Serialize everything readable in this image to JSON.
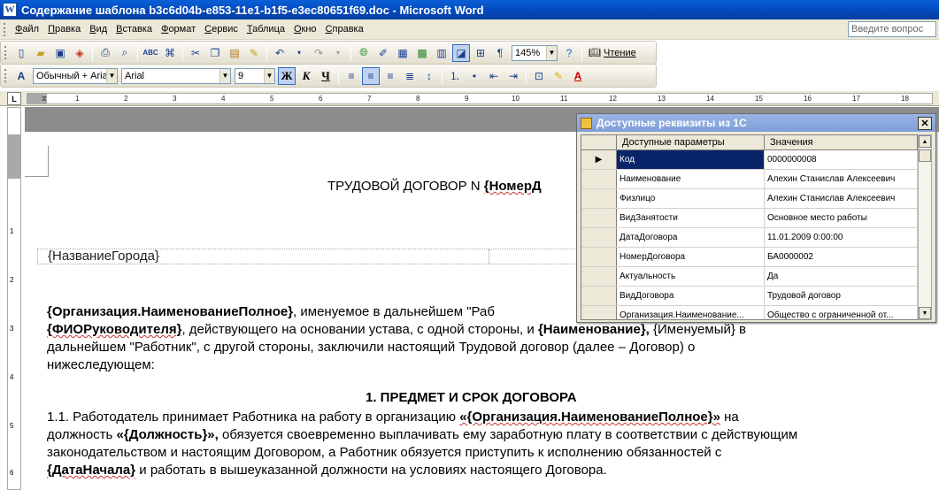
{
  "window": {
    "title": "Содержание шаблона b3c6d04b-e853-11e1-b1f5-e3ec80651f69.doc - Microsoft Word"
  },
  "menu": {
    "items": [
      "Файл",
      "Правка",
      "Вид",
      "Вставка",
      "Формат",
      "Сервис",
      "Таблица",
      "Окно",
      "Справка"
    ],
    "ask_placeholder": "Введите вопрос"
  },
  "toolbar": {
    "zoom": "145%",
    "read_label": "Чтение",
    "style": "Обычный + Arial",
    "font": "Arial",
    "size": "9"
  },
  "ruler": {
    "ticks": [
      "1",
      "1",
      "2",
      "3",
      "4",
      "5",
      "6",
      "7",
      "8",
      "9",
      "10",
      "11",
      "12",
      "13",
      "14",
      "15",
      "16",
      "17",
      "18"
    ]
  },
  "document": {
    "title_prefix": "ТРУДОВОЙ ДОГОВОР N ",
    "title_field": "{НомерД",
    "city_field": "{НазваниеГорода}",
    "para1_line1_bold": "{Организация.НаименованиеПолное}",
    "para1_line1_rest": ", именуемое в дальнейшем \"Раб",
    "para1_line2_bold1": "{ФИОРуководителя}",
    "para1_line2_mid": ", действующего на основании устава, с одной стороны, и ",
    "para1_line2_bold2": "{Наименование},",
    "para1_line2_end": " {Именуемый} в",
    "para1_line3": "дальнейшем \"Работник\", с другой стороны, заключили настоящий Трудовой договор (далее – Договор) о",
    "para1_line4": "нижеследующем:",
    "section1": "1. ПРЕДМЕТ И СРОК ДОГОВОРА",
    "p11_line1_start": "1.1. Работодатель принимает Работника на работу в организацию ",
    "p11_line1_bold": "«{Организация.НаименованиеПолное}»",
    "p11_line1_end": " на",
    "p11_line2_start": "должность ",
    "p11_line2_bold": "«{Должность}»,",
    "p11_line2_end": " обязуется своевременно выплачивать ему заработную плату в соответствии с действующим",
    "p11_line3": "законодательством и настоящим Договором, а Работник обязуется приступить к исполнению обязанностей с",
    "p11_line4_bold": "{ДатаНачала}",
    "p11_line4_end": " и работать в вышеуказанной должности на условиях настоящего Договора."
  },
  "panel": {
    "title": "Доступные реквизиты из 1С",
    "col_param": "Доступные параметры",
    "col_value": "Значения",
    "rows": [
      {
        "param": "Код",
        "value": "0000000008"
      },
      {
        "param": "Наименование",
        "value": "Алехин Станислав Алексеевич"
      },
      {
        "param": "Физлицо",
        "value": "Алехин Станислав Алексеевич"
      },
      {
        "param": "ВидЗанятости",
        "value": "Основное место работы"
      },
      {
        "param": "ДатаДоговора",
        "value": "11.01.2009 0:00:00"
      },
      {
        "param": "НомерДоговора",
        "value": "БА0000002"
      },
      {
        "param": "Актуальность",
        "value": "Да"
      },
      {
        "param": "ВидДоговора",
        "value": "Трудовой договор"
      },
      {
        "param": "Организация.Наименование...",
        "value": "Общество с ограниченной от..."
      }
    ]
  }
}
